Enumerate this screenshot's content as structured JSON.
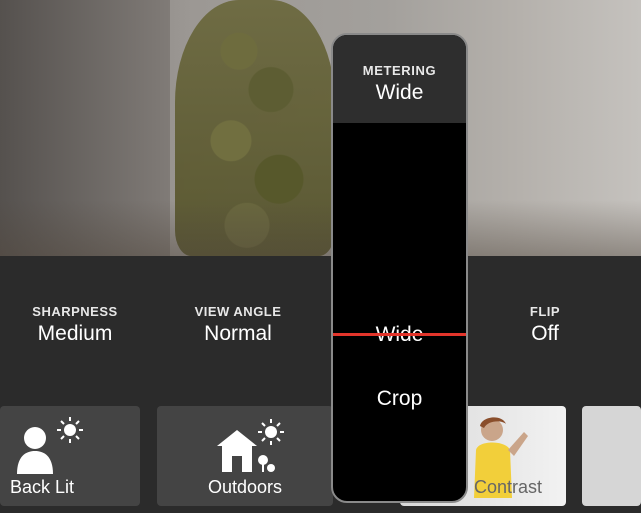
{
  "settings": [
    {
      "label": "SHARPNESS",
      "value": "Medium"
    },
    {
      "label": "VIEW ANGLE",
      "value": "Normal"
    },
    {
      "label": "FLIP",
      "value": "Off"
    }
  ],
  "presets": [
    {
      "label": "Back Lit",
      "icon": "person-sun-icon"
    },
    {
      "label": "Outdoors",
      "icon": "house-sun-icon"
    },
    {
      "label": "Contrast",
      "icon": "photo-thumbnail"
    },
    {
      "label": "",
      "icon": "blank-thumbnail"
    }
  ],
  "metering": {
    "label": "METERING",
    "value": "Wide",
    "options": [
      "Wide",
      "Crop"
    ],
    "selected": "Wide",
    "accent": "#e3352b"
  }
}
